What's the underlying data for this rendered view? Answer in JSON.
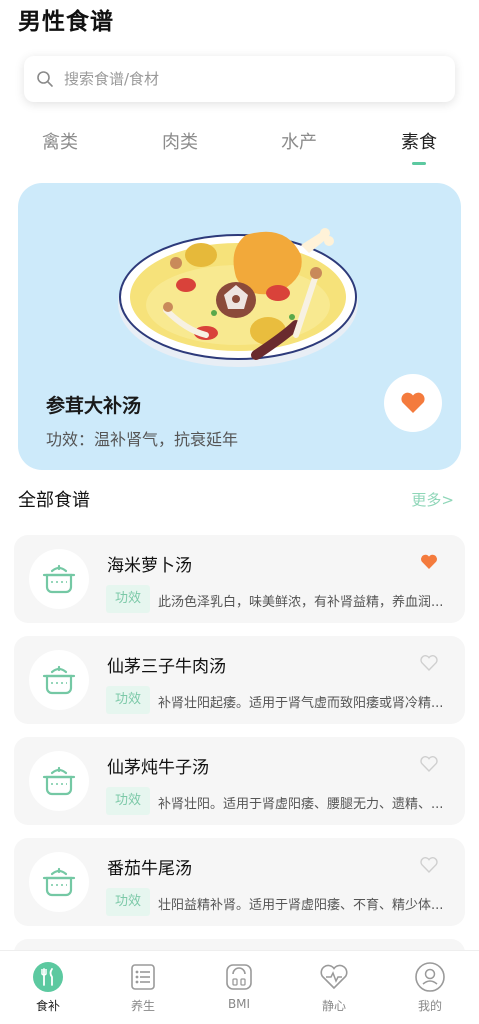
{
  "page": {
    "title": "男性食谱"
  },
  "search": {
    "placeholder": "搜索食谱/食材",
    "value": ""
  },
  "tabs": [
    {
      "label": "禽类",
      "active": false
    },
    {
      "label": "肉类",
      "active": false
    },
    {
      "label": "水产",
      "active": false
    },
    {
      "label": "素食",
      "active": true
    }
  ],
  "featured": {
    "name": "参茸大补汤",
    "effect": "功效：温补肾气，抗衰延年",
    "favorited": true
  },
  "section": {
    "title": "全部食谱",
    "more": "更多>"
  },
  "recipes": [
    {
      "name": "海米萝卜汤",
      "badge": "功效",
      "desc": "此汤色泽乳白，味美鲜浓，有补肾益精，养血润...",
      "favorited": true
    },
    {
      "name": "仙茅三子牛肉汤",
      "badge": "功效",
      "desc": "补肾壮阳起痿。适用于肾气虚而致阳痿或肾冷精...",
      "favorited": false
    },
    {
      "name": "仙茅炖牛子汤",
      "badge": "功效",
      "desc": "补肾壮阳。适用于肾虚阳痿、腰腿无力、遗精、...",
      "favorited": false
    },
    {
      "name": "番茄牛尾汤",
      "badge": "功效",
      "desc": "壮阳益精补肾。适用于肾虚阳痿、不育、精少体...",
      "favorited": false
    }
  ],
  "nav": [
    {
      "label": "食补",
      "icon": "food-tonic-icon",
      "active": true
    },
    {
      "label": "养生",
      "icon": "health-list-icon",
      "active": false
    },
    {
      "label": "BMI",
      "icon": "scale-icon",
      "active": false
    },
    {
      "label": "静心",
      "icon": "heart-pulse-icon",
      "active": false
    },
    {
      "label": "我的",
      "icon": "profile-icon",
      "active": false
    }
  ],
  "colors": {
    "accent": "#5cc9a0",
    "favorite": "#f47b3d",
    "featured_bg": "#cdeafa",
    "card_bg": "#f6f6f6"
  }
}
